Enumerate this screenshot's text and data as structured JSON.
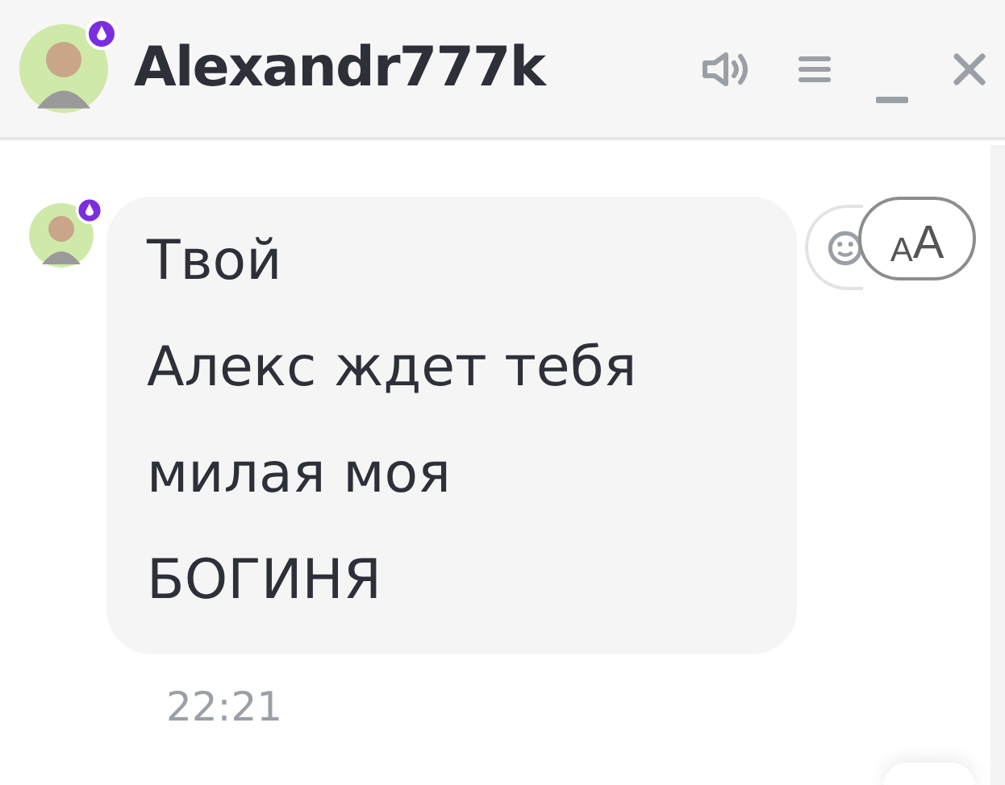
{
  "header": {
    "title": "Alexandr777k",
    "avatar_badge": true
  },
  "message": {
    "avatar_badge": true,
    "lines": [
      "Твой",
      "Алекс ждет тебя",
      "милая моя",
      "БОГИНЯ"
    ],
    "time": "22:21"
  },
  "text_size_button": {
    "small_letter": "A",
    "large_letter": "A"
  }
}
